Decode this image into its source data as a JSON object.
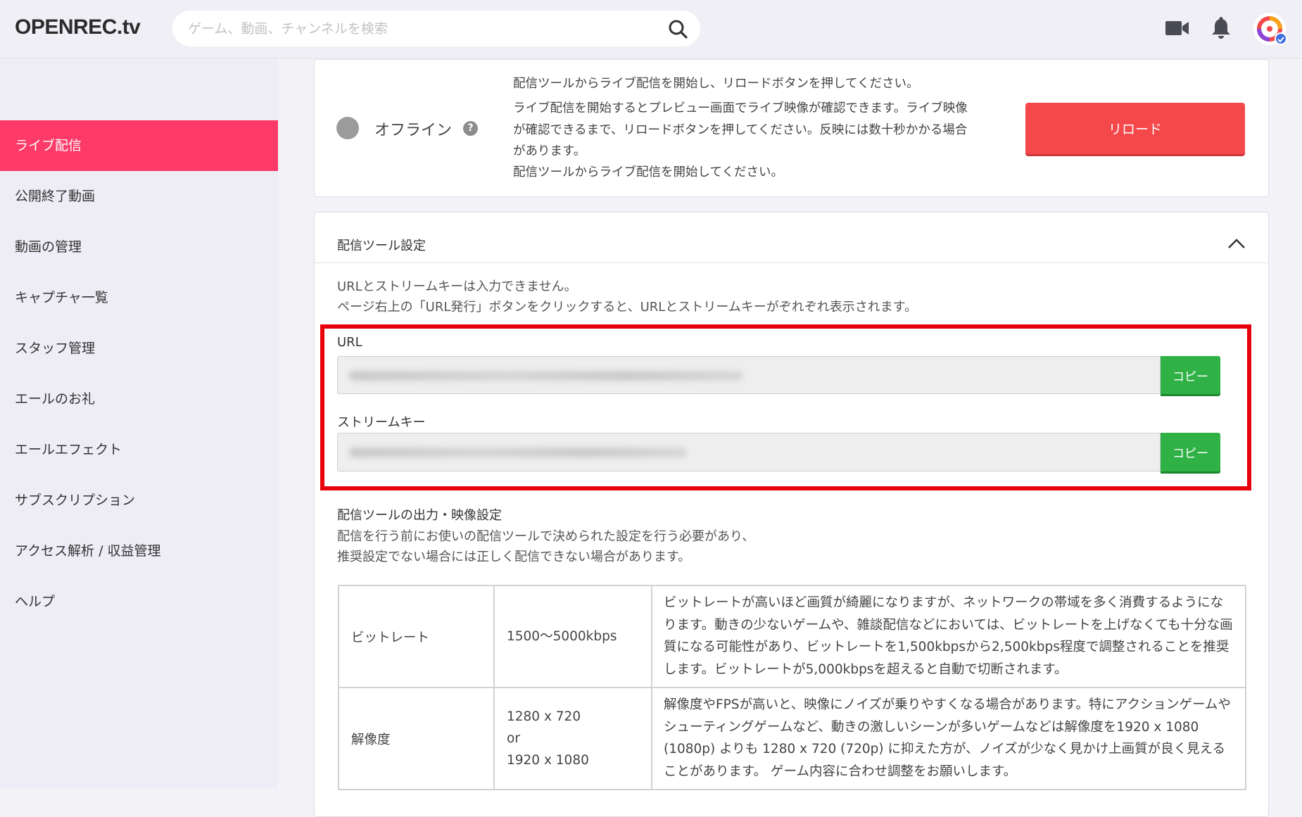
{
  "header": {
    "logo": "OPENREC.tv",
    "search_placeholder": "ゲーム、動画、チャンネルを検索"
  },
  "sidebar": {
    "active_index": 0,
    "items": [
      {
        "label": "ライブ配信"
      },
      {
        "label": "公開終了動画"
      },
      {
        "label": "動画の管理"
      },
      {
        "label": "キャプチャ一覧"
      },
      {
        "label": "スタッフ管理"
      },
      {
        "label": "エールのお礼"
      },
      {
        "label": "エールエフェクト"
      },
      {
        "label": "サブスクリプション"
      },
      {
        "label": "アクセス解析 / 収益管理"
      },
      {
        "label": "ヘルプ"
      }
    ]
  },
  "status": {
    "label": "オフライン",
    "help_glyph": "?",
    "message_1": "配信ツールからライブ配信を開始し、リロードボタンを押してください。",
    "message_2": "ライブ配信を開始するとプレビュー画面でライブ映像が確認できます。ライブ映像が確認できるまで、リロードボタンを押してください。反映には数十秒かかる場合があります。",
    "message_3": "配信ツールからライブ配信を開始してください。",
    "reload_label": "リロード",
    "colors": {
      "offline": "#9b9b9b",
      "reload": "#f5484b"
    }
  },
  "settings": {
    "title": "配信ツール設定",
    "note_1": "URLとストリームキーは入力できません。",
    "note_2": "ページ右上の「URL発行」ボタンをクリックすると、URLとストリームキーがぞれぞれ表示されます。",
    "url_label": "URL",
    "stream_key_label": "ストリームキー",
    "copy_label": "コピー",
    "output_title": "配信ツールの出力・映像設定",
    "output_desc_1": "配信を行う前にお使いの配信ツールで決められた設定を行う必要があり、",
    "output_desc_2": "推奨設定でない場合には正しく配信できない場合があります。",
    "table": [
      {
        "name": "ビットレート",
        "values": [
          "1500〜5000kbps"
        ],
        "desc": "ビットレートが高いほど画質が綺麗になりますが、ネットワークの帯域を多く消費するようになります。動きの少ないゲームや、雑談配信などにおいては、ビットレートを上げなくても十分な画質になる可能性があり、ビットレートを1,500kbpsから2,500kbps程度で調整されることを推奨します。ビットレートが5,000kbpsを超えると自動で切断されます。"
      },
      {
        "name": "解像度",
        "values": [
          "1280 x 720",
          "or",
          "1920 x 1080"
        ],
        "desc": "解像度やFPSが高いと、映像にノイズが乗りやすくなる場合があります。特にアクションゲームやシューティングゲームなど、動きの激しいシーンが多いゲームなどは解像度を1920 x 1080 (1080p) よりも 1280 x 720 (720p) に抑えた方が、ノイズが少なく見かけ上画質が良く見えることがあります。 ゲーム内容に合わせ調整をお願いします。"
      }
    ],
    "colors": {
      "copy": "#2fb146",
      "highlight": "#e8000d",
      "active_nav": "#fd3a68"
    }
  },
  "icons": [
    "search-icon",
    "camera-icon",
    "bell-icon",
    "avatar",
    "help-icon",
    "chevron-up-icon"
  ]
}
